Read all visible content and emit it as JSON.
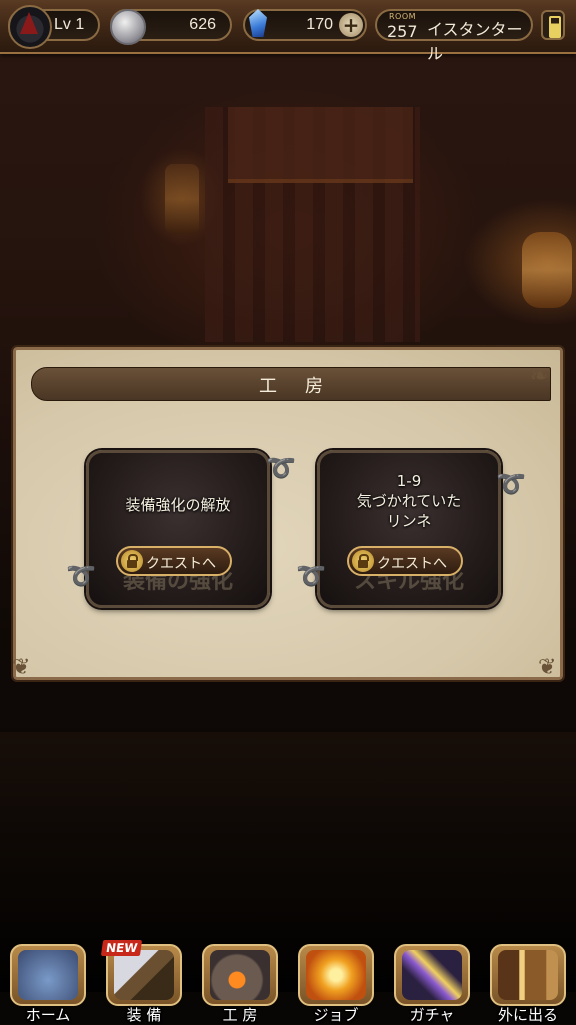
{
  "header": {
    "level_label": "Lv 1",
    "coins": "626",
    "gems": "170",
    "room_label": "ROOM",
    "room_number": "257",
    "location": "イスタンタール"
  },
  "panel": {
    "title": "工房",
    "cards": [
      {
        "title": "装備強化の解放",
        "art_text": "装備の強化",
        "button_label": "クエストへ"
      },
      {
        "title": "1-9\n気づかれていた\nリンネ",
        "art_text": "スキル強化",
        "button_label": "クエストへ"
      }
    ]
  },
  "nav": {
    "items": [
      {
        "label": "ホーム",
        "icon": "home-tower-icon"
      },
      {
        "label": "装 備",
        "icon": "sword-icon",
        "badge": "NEW"
      },
      {
        "label": "工 房",
        "icon": "forge-icon"
      },
      {
        "label": "ジョブ",
        "icon": "job-gem-icon"
      },
      {
        "label": "ガチャ",
        "icon": "gacha-wand-icon"
      },
      {
        "label": "外に出る",
        "icon": "exit-door-icon"
      }
    ]
  },
  "colors": {
    "panel_bg": "#d6c8aa",
    "header_bar": "#4a3624",
    "accent_gold": "#d8b068",
    "badge_red": "#c8281a"
  }
}
